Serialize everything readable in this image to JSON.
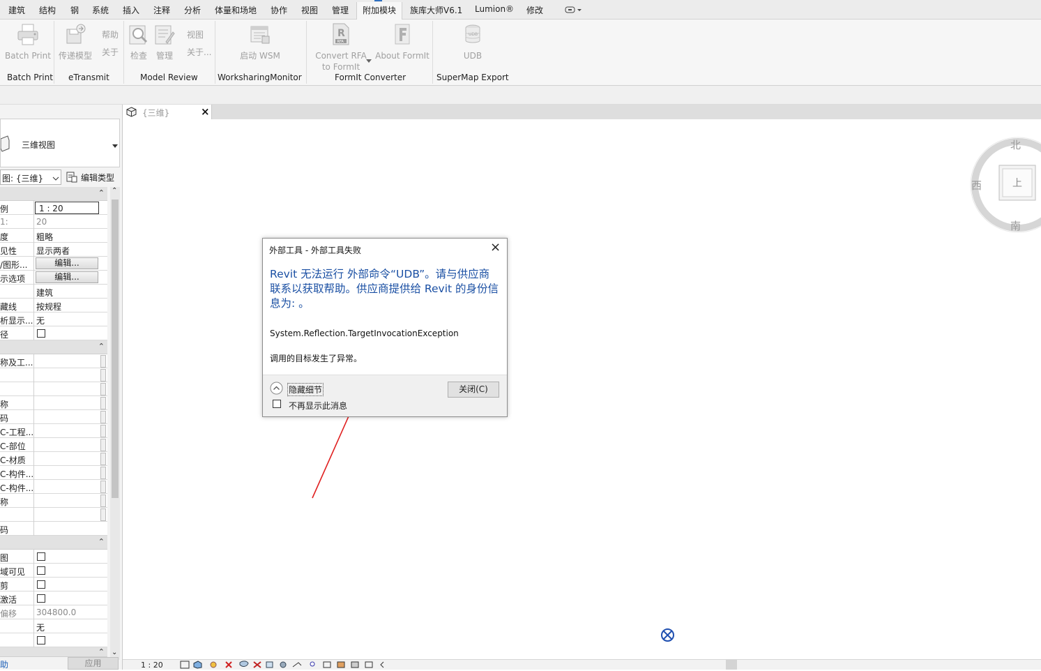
{
  "ribbon_tabs": [
    "建筑",
    "结构",
    "钢",
    "系统",
    "插入",
    "注释",
    "分析",
    "体量和场地",
    "协作",
    "视图",
    "管理",
    "附加模块",
    "族库大师V6.1",
    "Lumion®",
    "修改"
  ],
  "active_tab": "附加模块",
  "ribbon_buttons": {
    "batch_print": "Batch Print",
    "transmit": "传递模型",
    "help_top": "帮助",
    "help_about": "关于",
    "check": "检查",
    "manage": "管理",
    "view_top": "视图",
    "view_about": "关于...",
    "start_wsm": "启动 WSM",
    "convert_rfa_1": "Convert RFA",
    "convert_rfa_2": "to FormIt",
    "about_formit": "About FormIt",
    "udb": "UDB",
    "udb_icon_text": "UDB",
    "rfa_icon_text": "RFA"
  },
  "ribbon_groups": [
    "Batch Print",
    "eTransmit",
    "Model Review",
    "WorksharingMonitor",
    "FormIt Converter",
    "SuperMap Export"
  ],
  "properties": {
    "type_name": "三维视图",
    "view_selector": "图: {三维}",
    "edit_type": "编辑类型",
    "rows_1": [
      {
        "key": "例",
        "value": "1 : 20",
        "kind": "input"
      },
      {
        "key": "1:",
        "value": "20",
        "kind": "grey"
      },
      {
        "key": "度",
        "value": "粗略",
        "kind": "text"
      },
      {
        "key": "见性",
        "value": "显示两者",
        "kind": "text"
      },
      {
        "key": "/图形...",
        "value": "编辑...",
        "kind": "button"
      },
      {
        "key": "示选项",
        "value": "编辑...",
        "kind": "button"
      },
      {
        "key": "",
        "value": "建筑",
        "kind": "text"
      },
      {
        "key": "藏线",
        "value": "按规程",
        "kind": "text"
      },
      {
        "key": "析显示...",
        "value": "无",
        "kind": "text"
      },
      {
        "key": "径",
        "value": "",
        "kind": "check"
      }
    ],
    "rows_2": [
      {
        "key": "称及工...",
        "value": ""
      },
      {
        "key": "",
        "value": ""
      },
      {
        "key": "",
        "value": ""
      },
      {
        "key": "称",
        "value": ""
      },
      {
        "key": "码",
        "value": ""
      },
      {
        "key": "C-工程...",
        "value": ""
      },
      {
        "key": "C-部位",
        "value": ""
      },
      {
        "key": "C-材质",
        "value": ""
      },
      {
        "key": "C-构件...",
        "value": ""
      },
      {
        "key": "C-构件...",
        "value": ""
      },
      {
        "key": "称",
        "value": ""
      },
      {
        "key": "",
        "value": ""
      },
      {
        "key": "码",
        "value": ""
      }
    ],
    "rows_3": [
      {
        "key": "图",
        "value": "",
        "kind": "check"
      },
      {
        "key": "域可见",
        "value": "",
        "kind": "check"
      },
      {
        "key": "剪",
        "value": "",
        "kind": "check"
      },
      {
        "key": "激活",
        "value": "",
        "kind": "check"
      },
      {
        "key": "偏移",
        "value": "304800.0",
        "kind": "grey"
      },
      {
        "key": "",
        "value": "无",
        "kind": "text"
      },
      {
        "key": "",
        "value": "",
        "kind": "check"
      }
    ],
    "help_link": "助",
    "apply": "应用"
  },
  "view_tab": "{三维}",
  "viewcube": {
    "north": "北",
    "west": "西",
    "south": "南",
    "face": "上"
  },
  "status_scale": "1 : 20",
  "dialog": {
    "title": "外部工具 - 外部工具失败",
    "main_message": "Revit 无法运行 外部命令“UDB”。请与供应商联系以获取帮助。供应商提供给 Revit 的身份信息为: 。",
    "exception": "System.Reflection.TargetInvocationException",
    "detail": "调用的目标发生了异常。",
    "hide_details": "隐藏细节",
    "dont_show": "不再显示此消息",
    "close_button": "关闭(C)"
  },
  "colors": {
    "dialog_message": "#1a4fa3",
    "annotation_arrow": "#e02020",
    "crosshair": "#1f4fb0"
  }
}
